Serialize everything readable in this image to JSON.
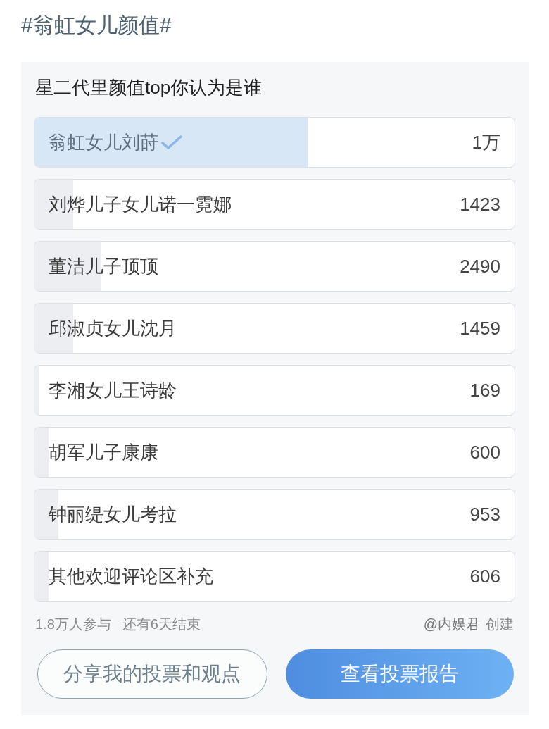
{
  "topic": "#翁虹女儿颜值#",
  "poll": {
    "question": "星二代里颜值top你认为是谁",
    "options": [
      {
        "label": "翁虹女儿刘莳",
        "count": "1万",
        "level": 0.57,
        "selected": true
      },
      {
        "label": "刘烨儿子女儿诺一霓娜",
        "count": "1423",
        "level": 0.08,
        "selected": false
      },
      {
        "label": "董洁儿子顶顶",
        "count": "2490",
        "level": 0.14,
        "selected": false
      },
      {
        "label": "邱淑贞女儿沈月",
        "count": "1459",
        "level": 0.08,
        "selected": false
      },
      {
        "label": "李湘女儿王诗龄",
        "count": "169",
        "level": 0.01,
        "selected": false
      },
      {
        "label": "胡军儿子康康",
        "count": "600",
        "level": 0.03,
        "selected": false
      },
      {
        "label": "钟丽缇女儿考拉",
        "count": "953",
        "level": 0.05,
        "selected": false
      },
      {
        "label": "其他欢迎评论区补充",
        "count": "606",
        "level": 0.03,
        "selected": false
      }
    ],
    "participants": "1.8万人参与",
    "time_left": "还有6天结束",
    "creator": "@内娱君",
    "created_label": "创建",
    "buttons": [
      {
        "label": "分享我的投票和观点",
        "kind": "outline"
      },
      {
        "label": "查看投票报告",
        "kind": "primary"
      }
    ]
  }
}
